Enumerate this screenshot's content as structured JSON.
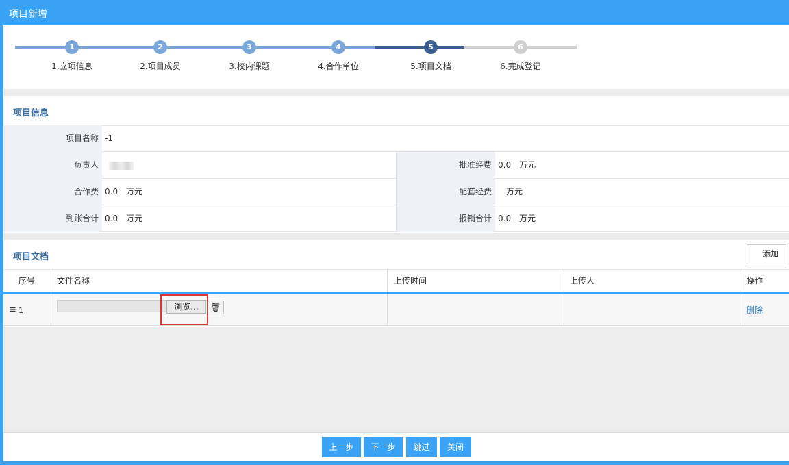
{
  "window": {
    "title": "项目新增"
  },
  "steps": [
    {
      "num": "1",
      "label": "1.立项信息",
      "state": "done"
    },
    {
      "num": "2",
      "label": "2.项目成员",
      "state": "done"
    },
    {
      "num": "3",
      "label": "3.校内课题",
      "state": "done"
    },
    {
      "num": "4",
      "label": "4.合作单位",
      "state": "done"
    },
    {
      "num": "5",
      "label": "5.项目文档",
      "state": "current"
    },
    {
      "num": "6",
      "label": "6.完成登记",
      "state": "todo"
    }
  ],
  "colors": {
    "accent": "#3aa3f5",
    "done": "#7aa7d9",
    "current": "#3a5f8f",
    "todo": "#cfcfcf",
    "highlight": "#e03535"
  },
  "project_info": {
    "heading": "项目信息",
    "name_label": "项目名称",
    "name_value": "-1",
    "leader_label": "负责人",
    "approved_label": "批准经费",
    "approved_value": "0.0",
    "approved_unit": "万元",
    "coop_label": "合作费",
    "coop_value": "0.0",
    "coop_unit": "万元",
    "matching_label": "配套经费",
    "matching_unit": "万元",
    "arrival_label": "到账合计",
    "arrival_value": "0.0",
    "arrival_unit": "万元",
    "reimburse_label": "报销合计",
    "reimburse_value": "0.0",
    "reimburse_unit": "万元"
  },
  "documents": {
    "heading": "项目文档",
    "add_label": "添加",
    "columns": [
      "序号",
      "文件名称",
      "上传时间",
      "上传人",
      "操作"
    ],
    "rows": [
      {
        "index": "1",
        "browse_label": "浏览...",
        "trash_icon": "🗑",
        "action": "删除"
      }
    ]
  },
  "footer": {
    "prev": "上一步",
    "next": "下一步",
    "skip": "跳过",
    "close": "关闭"
  }
}
